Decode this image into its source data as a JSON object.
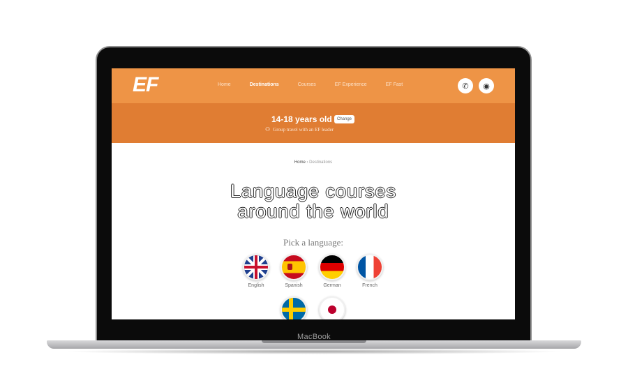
{
  "device": {
    "label": "MacBook"
  },
  "header": {
    "logo": "EF",
    "nav": [
      "Home",
      "Destinations",
      "Courses",
      "EF Experience",
      "EF Fast"
    ],
    "active_nav": "Destinations",
    "icons": [
      "phone-icon",
      "location-icon"
    ]
  },
  "age": {
    "title": "14-18 years old",
    "change_label": "Change",
    "group_text": "Group travel with an EF leader",
    "group_icon": "group-icon"
  },
  "breadcrumb": {
    "home": "Home",
    "separator": "›",
    "current": "Destinations"
  },
  "main": {
    "headline_line1": "Language courses",
    "headline_line2": "around the world",
    "pick_label": "Pick a language:"
  },
  "languages": [
    {
      "label": "English"
    },
    {
      "label": "Spanish"
    },
    {
      "label": "German"
    },
    {
      "label": "French"
    },
    {
      "label": ""
    },
    {
      "label": ""
    }
  ],
  "colors": {
    "header": "#ee9446",
    "age_bar": "#e07d33",
    "white": "#ffffff"
  }
}
